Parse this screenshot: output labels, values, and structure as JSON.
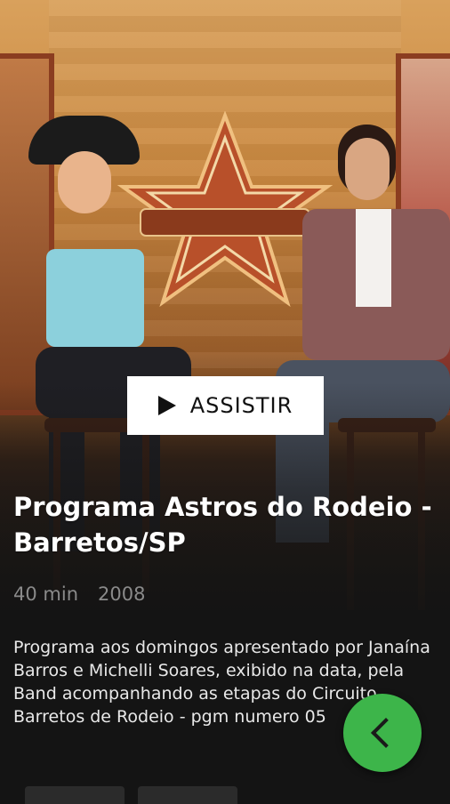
{
  "player": {
    "play_label": "ASSISTIR"
  },
  "program": {
    "title": "Programa Astros do Rodeio - Barretos/SP",
    "duration": "40 min",
    "year": "2008",
    "description": "Programa aos domingos apresentado por Janaína Barros e Michelli Soares, exibido na data, pela Band acompanhando as etapas do Circuito Barretos de Rodeio - pgm numero 05"
  },
  "icons": {
    "play": "play-icon",
    "back": "chevron-left-icon"
  },
  "colors": {
    "accent": "#3db54a",
    "background": "#141414",
    "meta_text": "#8a8a8a"
  }
}
